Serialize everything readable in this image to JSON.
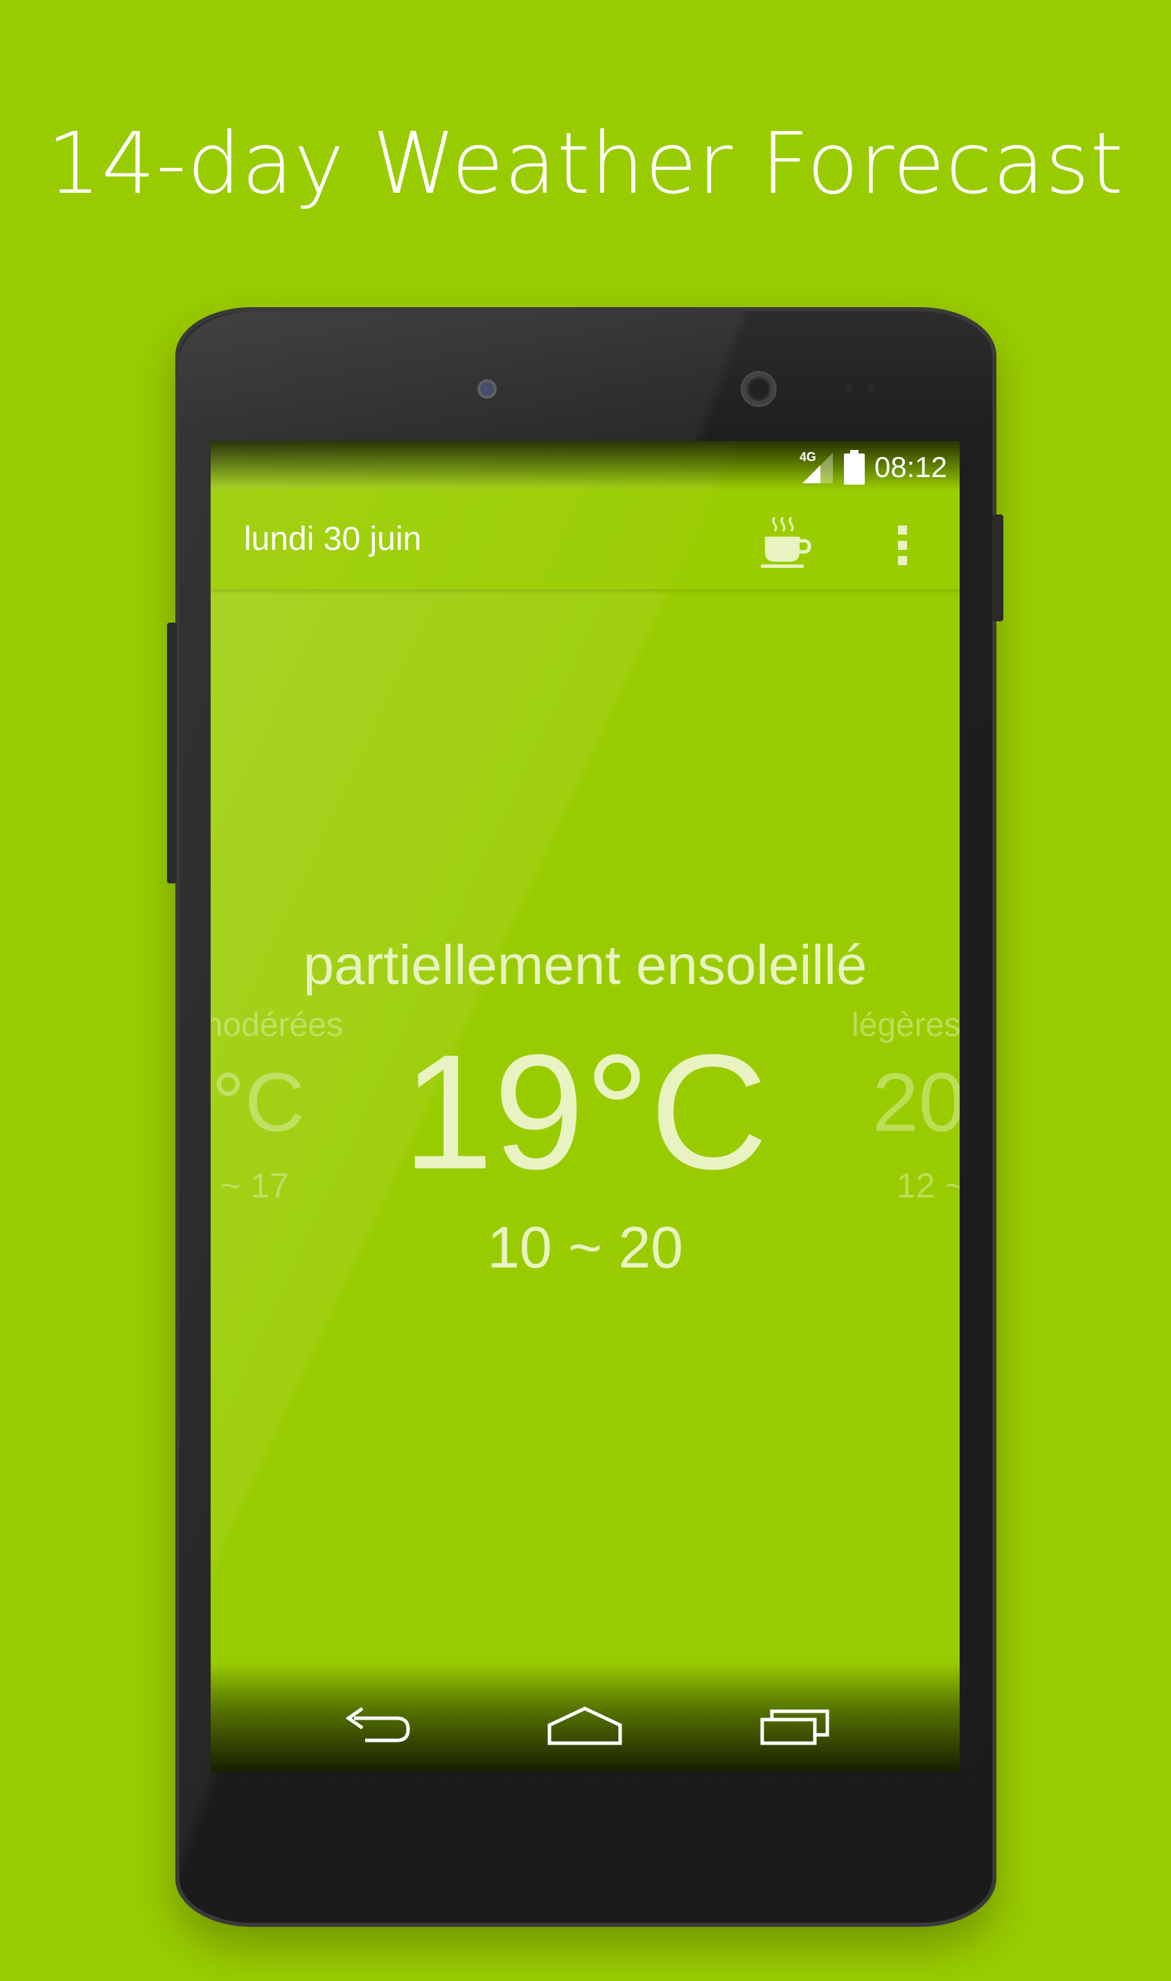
{
  "promo": {
    "headline": "14-day Weather Forecast"
  },
  "status_bar": {
    "network": "4G",
    "time": "08:12"
  },
  "app_bar": {
    "title": "lundi 30 juin"
  },
  "current": {
    "condition": "partiellement ensoleillé",
    "temperature": "19°C",
    "range": "10 ~ 20"
  },
  "prev_day": {
    "condition": "modérées",
    "temperature": "°C",
    "range": "~ 17"
  },
  "next_day": {
    "condition": "légères",
    "temperature": "20",
    "range": "12 ~"
  },
  "colors": {
    "background": "#99cc00",
    "text": "#e9f3c2",
    "phone": "#1e1e1e"
  },
  "icons": [
    "network-4g-icon",
    "signal-icon",
    "battery-icon",
    "coffee-cup-icon",
    "overflow-menu-icon",
    "back-icon",
    "home-icon",
    "recent-apps-icon"
  ]
}
